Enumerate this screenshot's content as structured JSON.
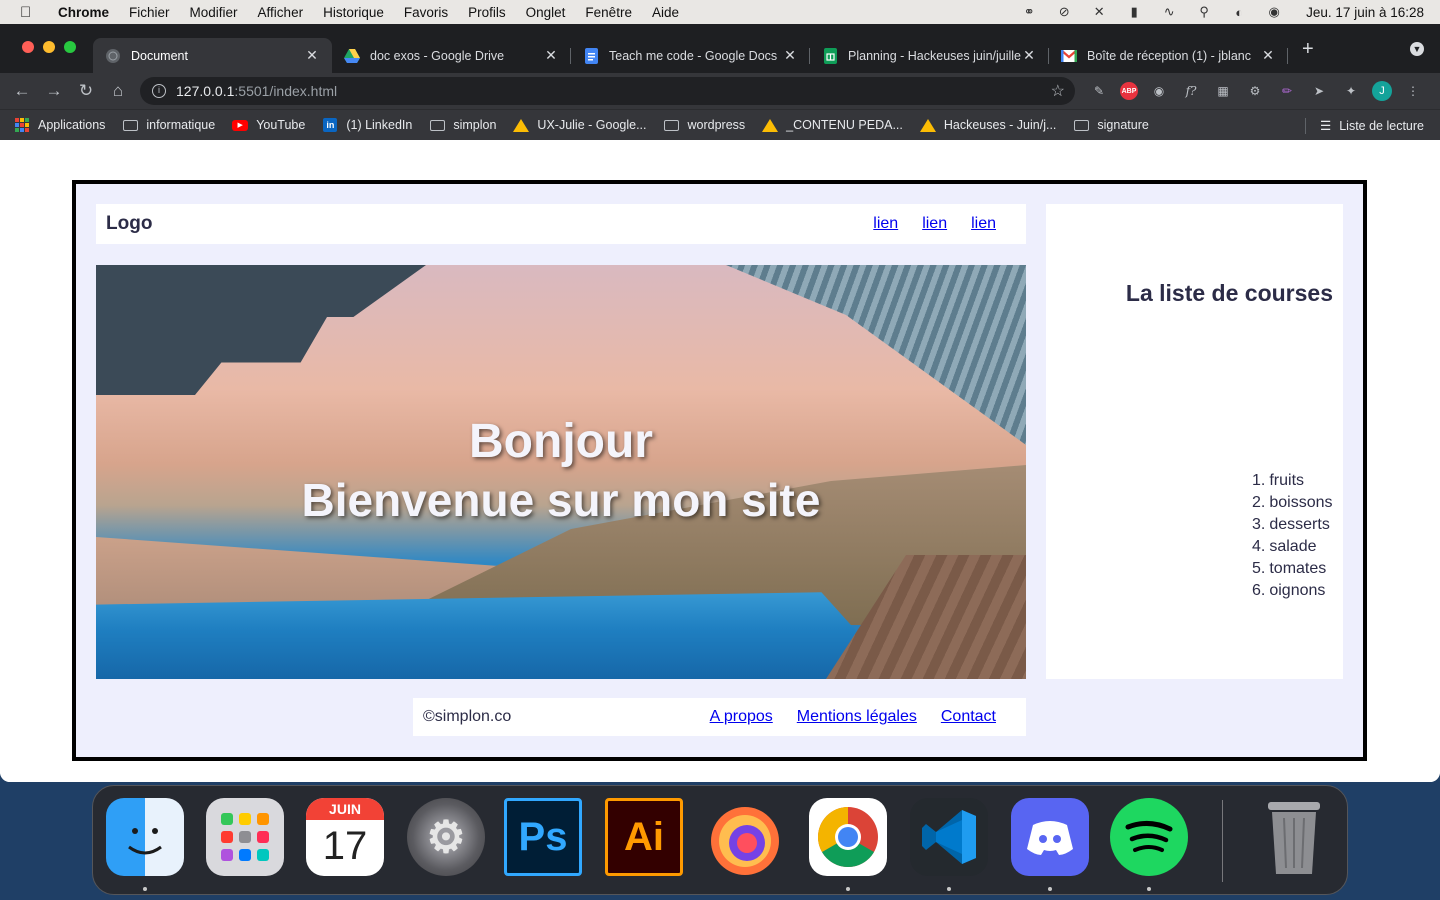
{
  "menubar": {
    "app": "Chrome",
    "items": [
      "Fichier",
      "Modifier",
      "Afficher",
      "Historique",
      "Favoris",
      "Profils",
      "Onglet",
      "Fenêtre",
      "Aide"
    ],
    "clock": "Jeu. 17 juin à  16:28"
  },
  "tabs": [
    {
      "title": "Document",
      "icon": "globe-icon"
    },
    {
      "title": "doc exos - Google Drive",
      "icon": "google-drive-icon"
    },
    {
      "title": "Teach me code - Google Docs",
      "icon": "google-docs-icon"
    },
    {
      "title": "Planning - Hackeuses juin/juille",
      "icon": "google-sheets-icon"
    },
    {
      "title": "Boîte de réception (1) - jblanc",
      "icon": "gmail-icon"
    }
  ],
  "address_bar": {
    "host": "127.0.0.1",
    "rest": ":5501/index.html"
  },
  "profile_initial": "J",
  "ext_abp_label": "ABP",
  "bookmarks": {
    "items": [
      "Applications",
      "informatique",
      "YouTube",
      "(1) LinkedIn",
      "simplon",
      "UX-Julie - Google...",
      "wordpress",
      "_CONTENU PEDA...",
      "Hackeuses - Juin/j...",
      "signature"
    ],
    "reading_list": "Liste de lecture",
    "linkedin_mark": "in"
  },
  "page": {
    "logo": "Logo",
    "nav": [
      "lien",
      "lien",
      "lien"
    ],
    "hero": {
      "line1": "Bonjour",
      "line2": "Bienvenue sur mon site"
    },
    "aside": {
      "title": "La liste de courses",
      "list": [
        "fruits",
        "boissons",
        "desserts",
        "salade",
        "tomates",
        "oignons"
      ]
    },
    "footer": {
      "copyright": "©simplon.co",
      "links": [
        "A propos",
        "Mentions légales",
        "Contact"
      ]
    }
  },
  "dock": {
    "calendar_month": "JUIN",
    "calendar_day": "17",
    "photoshop_label": "Ps",
    "illustrator_label": "Ai"
  }
}
